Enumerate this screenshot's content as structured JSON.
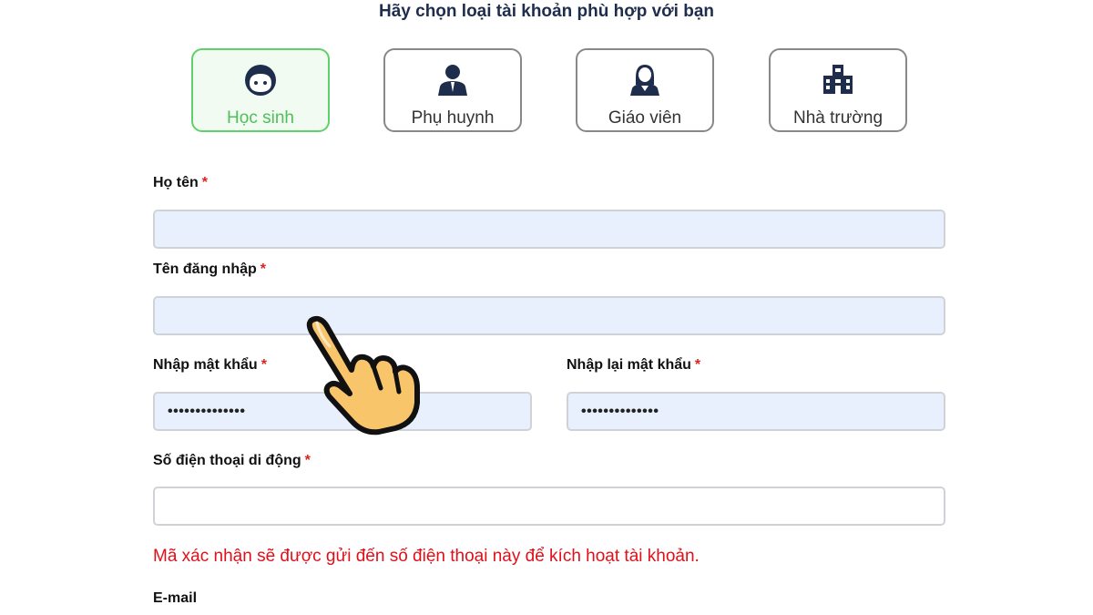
{
  "page": {
    "heading": "Hãy chọn loại tài khoản phù hợp với bạn"
  },
  "account_types": [
    {
      "label": "Học sinh",
      "icon": "student-face-icon",
      "selected": true
    },
    {
      "label": "Phụ huynh",
      "icon": "parent-person-icon",
      "selected": false
    },
    {
      "label": "Giáo viên",
      "icon": "teacher-person-icon",
      "selected": false
    },
    {
      "label": "Nhà trường",
      "icon": "school-building-icon",
      "selected": false
    }
  ],
  "form": {
    "required_mark": "*",
    "full_name": {
      "label": "Họ tên",
      "value": ""
    },
    "username": {
      "label": "Tên đăng nhập",
      "value": ""
    },
    "password": {
      "label": "Nhập mật khẩu",
      "value": "••••••••••••••"
    },
    "confirm_password": {
      "label": "Nhập lại mật khẩu",
      "value": "••••••••••••••"
    },
    "phone": {
      "label": "Số điện thoại di động",
      "value": ""
    },
    "phone_note": "Mã xác nhận sẽ được gửi đến số điện thoại này để kích hoạt tài khoản.",
    "email": {
      "label": "E-mail"
    }
  },
  "colors": {
    "selected_border": "#5fd06a",
    "selected_text": "#4fbf59",
    "input_fill": "#e8f0fd",
    "required": "#e0201a",
    "note": "#e0101a",
    "cursor_hand": "#f9c56a"
  },
  "overlay": {
    "icon": "pointing-hand-cursor-icon"
  }
}
